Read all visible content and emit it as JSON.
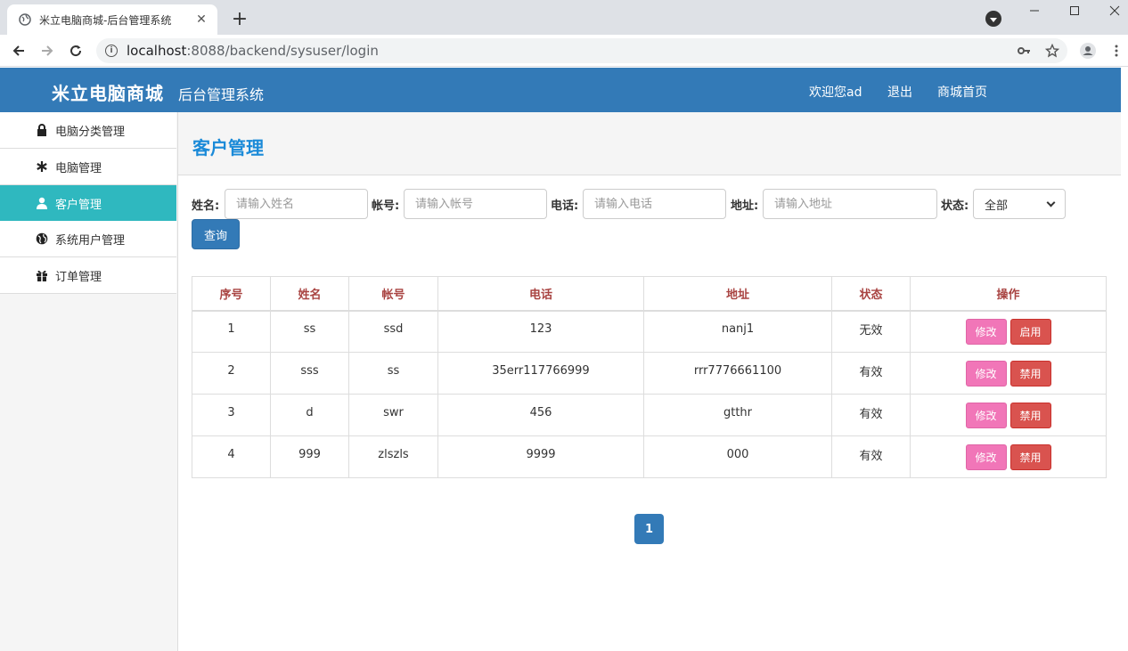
{
  "browser": {
    "tab_title": "米立电脑商城-后台管理系统",
    "url_host": "localhost",
    "url_path": ":8088/backend/sysuser/login"
  },
  "header": {
    "brand": "米立电脑商城",
    "subtitle": "后台管理系统",
    "welcome": "欢迎您ad",
    "logout": "退出",
    "home": "商城首页",
    "color": "#337ab7"
  },
  "sidebar": {
    "items": [
      {
        "label": "电脑分类管理",
        "icon": "lock-icon"
      },
      {
        "label": "电脑管理",
        "icon": "asterisk-icon"
      },
      {
        "label": "客户管理",
        "icon": "user-icon",
        "active": true
      },
      {
        "label": "系统用户管理",
        "icon": "globe-icon"
      },
      {
        "label": "订单管理",
        "icon": "gift-icon"
      }
    ]
  },
  "page": {
    "title": "客户管理"
  },
  "filters": {
    "name_label": "姓名:",
    "name_placeholder": "请输入姓名",
    "account_label": "帐号:",
    "account_placeholder": "请输入帐号",
    "phone_label": "电话:",
    "phone_placeholder": "请输入电话",
    "address_label": "地址:",
    "address_placeholder": "请输入地址",
    "status_label": "状态:",
    "status_value": "全部",
    "query_button": "查询"
  },
  "table": {
    "headers": [
      "序号",
      "姓名",
      "帐号",
      "电话",
      "地址",
      "状态",
      "操作"
    ],
    "rows": [
      {
        "id": "1",
        "name": "ss",
        "account": "ssd",
        "phone": "123",
        "address": "nanj1",
        "status": "无效",
        "edit": "修改",
        "toggle": "启用"
      },
      {
        "id": "2",
        "name": "sss",
        "account": "ss",
        "phone": "35err117766999",
        "address": "rrr7776661100",
        "status": "有效",
        "edit": "修改",
        "toggle": "禁用"
      },
      {
        "id": "3",
        "name": "d",
        "account": "swr",
        "phone": "456",
        "address": "gtthr",
        "status": "有效",
        "edit": "修改",
        "toggle": "禁用"
      },
      {
        "id": "4",
        "name": "999",
        "account": "zlszls",
        "phone": "9999",
        "address": "000",
        "status": "有效",
        "edit": "修改",
        "toggle": "禁用"
      }
    ]
  },
  "pagination": {
    "current": "1"
  }
}
